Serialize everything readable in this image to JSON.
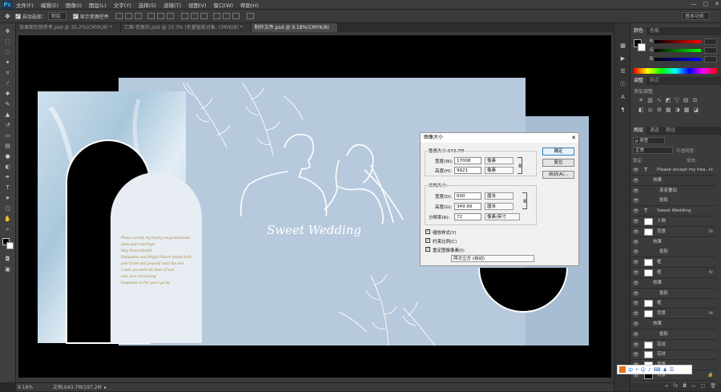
{
  "app": {
    "logo": "Ps"
  },
  "menu": [
    "文件(F)",
    "编辑(E)",
    "图像(I)",
    "图层(L)",
    "文字(Y)",
    "选择(S)",
    "滤镜(T)",
    "视图(V)",
    "窗口(W)",
    "帮助(H)"
  ],
  "window_controls": [
    "—",
    "□",
    "✕"
  ],
  "options": {
    "auto_select_label": "自动选择：",
    "auto_select_value": "图层",
    "show_transform_label": "显示变换控件",
    "workspace": "基本功能"
  },
  "tabs": [
    {
      "label": "效果图仅供参考.psd @ 35.2%(CMYK/8) *"
    },
    {
      "label": "汇图-恢复的.psd @ 33.3% (矢量智能对象, CMYK/8) *"
    },
    {
      "label": "制作文件.psd @ 9.18%(CMYK/8)"
    }
  ],
  "canvas": {
    "left_card_text": [
      "Please accept my hearty congratulations",
      "upon your marriage",
      "May Peace,Health",
      "Happiness and Bright Future attend both",
      "your bride and yourself until the end",
      "I wish you both the best of luck",
      "and, ever-increasing",
      "happiness in the years go by"
    ],
    "title_script": "Sweet Wedding",
    "colors": {
      "background": "#000000",
      "blue": "#b7c9dc",
      "cream": "#e8edf3",
      "gold": "#a68a3c"
    }
  },
  "status": {
    "zoom": "9.18%",
    "doc": "文档:643.7M/197.2M"
  },
  "right_panel": {
    "color_tabs": [
      "颜色",
      "色板"
    ],
    "color_channels": [
      "R",
      "G",
      "B"
    ],
    "adjust_tabs": [
      "调整",
      "样式"
    ],
    "adjust_label": "添加调整",
    "layer_tabs": [
      "图层",
      "通道",
      "路径"
    ],
    "kind_label": "ρ 类型",
    "blend_mode": "正常",
    "opacity_label": "不透明度:",
    "lock_label": "锁定:",
    "fill_label": "填充:",
    "layers": [
      {
        "name": "Please accept my hea...",
        "type": "text",
        "fx": "fx"
      },
      {
        "name": "效果",
        "type": "sub"
      },
      {
        "name": "渐变叠加",
        "type": "sub2"
      },
      {
        "name": "投影",
        "type": "sub2"
      },
      {
        "name": "Sweet  Wedding",
        "type": "text"
      },
      {
        "name": "人物",
        "type": "layer"
      },
      {
        "name": "背景",
        "type": "layer",
        "fx": "fx"
      },
      {
        "name": "效果",
        "type": "sub"
      },
      {
        "name": "投影",
        "type": "sub2"
      },
      {
        "name": "框",
        "type": "layer"
      },
      {
        "name": "框",
        "type": "layer",
        "fx": "fx"
      },
      {
        "name": "效果",
        "type": "sub"
      },
      {
        "name": "投影",
        "type": "sub2"
      },
      {
        "name": "框",
        "type": "layer"
      },
      {
        "name": "背景",
        "type": "layer",
        "fx": "fx"
      },
      {
        "name": "效果",
        "type": "sub"
      },
      {
        "name": "投影",
        "type": "sub2"
      },
      {
        "name": "花纹",
        "type": "layer"
      },
      {
        "name": "花纹",
        "type": "layer"
      },
      {
        "name": "背景",
        "type": "layer"
      },
      {
        "name": "背景",
        "type": "layer",
        "locked": true
      }
    ]
  },
  "dialog": {
    "title": "图像大小",
    "pixel_size": "像素大小:643.7M",
    "width_label": "宽度(W):",
    "width_value": "17008",
    "width_unit": "像素",
    "height_label": "高度(H):",
    "height_value": "9921",
    "height_unit": "像素",
    "doc_size": "文档大小:",
    "doc_width_label": "宽度(D):",
    "doc_width_value": "600",
    "doc_width_unit": "厘米",
    "doc_height_label": "高度(G):",
    "doc_height_value": "349.99",
    "doc_height_unit": "厘米",
    "resolution_label": "分辨率(R):",
    "resolution_value": "72",
    "resolution_unit": "像素/英寸",
    "scale_styles": "缩放样式(Y)",
    "constrain": "约束比例(C)",
    "resample": "重定图像像素(I):",
    "resample_method": "两次立方 (自动)",
    "ok": "确定",
    "reset": "复位",
    "auto": "自动(A)..."
  },
  "ime": {
    "label": "中"
  }
}
